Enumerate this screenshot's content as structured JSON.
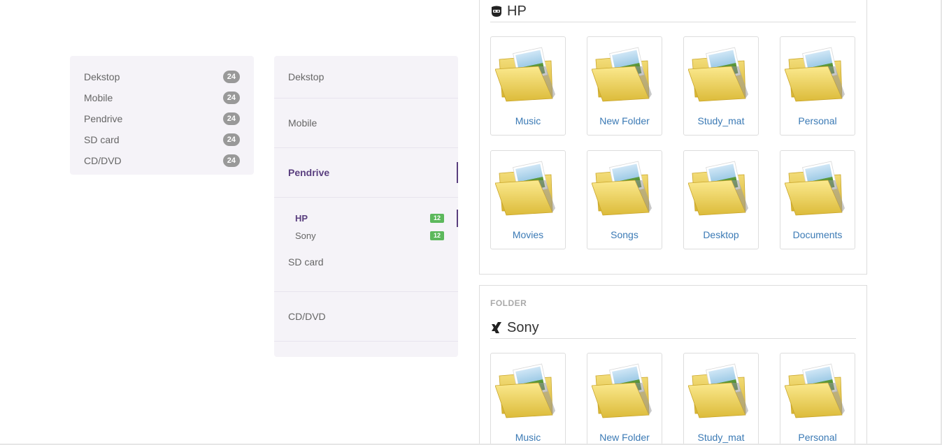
{
  "left_list": {
    "items": [
      {
        "label": "Dekstop",
        "count": "24"
      },
      {
        "label": "Mobile",
        "count": "24"
      },
      {
        "label": "Pendrive",
        "count": "24"
      },
      {
        "label": "SD card",
        "count": "24"
      },
      {
        "label": "CD/DVD",
        "count": "24"
      }
    ]
  },
  "accordion": {
    "items": {
      "desktop": "Dekstop",
      "mobile": "Mobile",
      "pendrive": "Pendrive",
      "sdcard": "SD card",
      "cddvd": "CD/DVD"
    },
    "pendrive_sub": [
      {
        "label": "HP",
        "count": "12"
      },
      {
        "label": "Sony",
        "count": "12"
      }
    ]
  },
  "hp_panel": {
    "title": "HP",
    "icon": "helmet-icon",
    "folders": [
      "Music",
      "New Folder",
      "Study_mat",
      "Personal",
      "Movies",
      "Songs",
      "Desktop",
      "Documents"
    ]
  },
  "sony_panel": {
    "kicker": "FOLDER",
    "title": "Sony",
    "icon": "xing-icon",
    "folders": [
      "Music",
      "New Folder",
      "Study_mat",
      "Personal"
    ]
  },
  "colors": {
    "accent_purple": "#5a3f7f",
    "link_blue": "#3b7ab5",
    "badge_gray": "#999999",
    "badge_green": "#5cb85c",
    "panel_bg": "#f5f3f8"
  }
}
